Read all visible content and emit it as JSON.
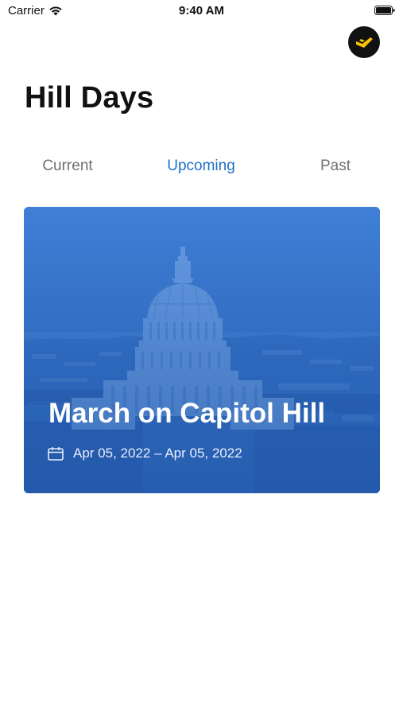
{
  "status_bar": {
    "carrier": "Carrier",
    "time": "9:40 AM"
  },
  "header": {
    "title": "Hill Days",
    "avatar_icon": "lightning-logo-icon"
  },
  "tabs": [
    {
      "label": "Current",
      "active": false
    },
    {
      "label": "Upcoming",
      "active": true
    },
    {
      "label": "Past",
      "active": false
    }
  ],
  "events": [
    {
      "title": "March on Capitol Hill",
      "date_range": "Apr 05, 2022 – Apr 05, 2022",
      "icon": "calendar-icon",
      "image": "capitol-building"
    }
  ],
  "colors": {
    "accent": "#1f6fc6",
    "card_overlay": "#2f6fc7",
    "inactive_tab": "#707070"
  }
}
